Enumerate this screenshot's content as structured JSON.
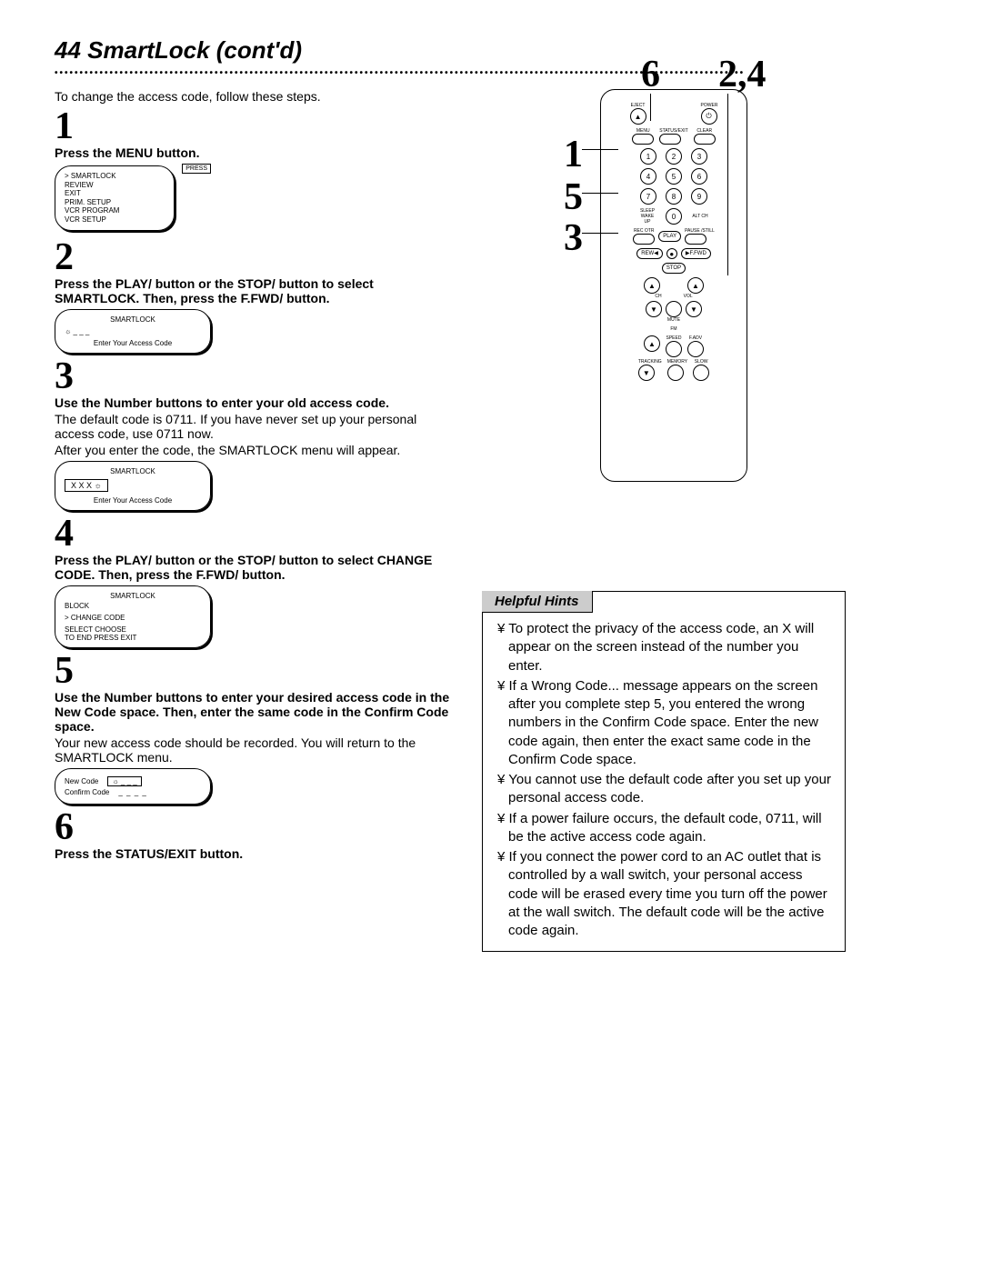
{
  "title": "44  SmartLock (cont'd)",
  "intro": "To change the access code, follow these steps.",
  "steps": {
    "s1": {
      "num": "1",
      "head": "Press the MENU button."
    },
    "s2": {
      "num": "2",
      "head": "Press the PLAY/   button or the STOP/   button to select SMARTLOCK. Then, press the F.FWD/   button."
    },
    "s3": {
      "num": "3",
      "head": "Use the Number buttons to enter your old access code.",
      "body1": "The default code is 0711. If you have never set up your personal access code, use 0711 now.",
      "body2": "After you enter the code, the SMARTLOCK menu will appear."
    },
    "s4": {
      "num": "4",
      "head": "Press the PLAY/   button or the STOP/   button to select CHANGE CODE. Then, press the F.FWD/   button."
    },
    "s5": {
      "num": "5",
      "head": "Use the Number buttons to enter your desired access code in the New Code space. Then, enter the same code in the Confirm Code space.",
      "body": "Your new access code should be recorded. You will return to the SMARTLOCK menu."
    },
    "s6": {
      "num": "6",
      "head": "Press the STATUS/EXIT button."
    }
  },
  "screens": {
    "menu": {
      "pressLabel": "PRESS",
      "items": [
        "> SMARTLOCK",
        "  REVIEW",
        "  EXIT",
        "  PRIM. SETUP",
        "  VCR PROGRAM",
        "  VCR SETUP"
      ]
    },
    "enterCode": {
      "title": "SMARTLOCK",
      "footer": "Enter Your Access Code"
    },
    "enterCodeX": {
      "title": "SMARTLOCK",
      "code": "X   X   X",
      "footer": "Enter Your Access Code"
    },
    "changeCode": {
      "title": "SMARTLOCK",
      "line1": "  BLOCK",
      "line2": "> CHANGE CODE",
      "line3": "SELECT      CHOOSE",
      "line4": "TO END  PRESS EXIT"
    },
    "newConfirm": {
      "l1": "New Code",
      "l2": "Confirm Code"
    }
  },
  "callouts": {
    "c6": "6",
    "c24": "2,4",
    "c1": "1",
    "c5": "5",
    "c3": "3"
  },
  "remote": {
    "topLabels": {
      "eject": "EJECT",
      "power": "POWER",
      "menu": "MENU",
      "status": "STATUS/EXIT",
      "clear": "CLEAR"
    },
    "numbers": [
      "1",
      "2",
      "3",
      "4",
      "5",
      "6",
      "7",
      "8",
      "9",
      "0"
    ],
    "sleep": "SLEEP\nWAKE UP",
    "altch": "ALT CH",
    "rec": "REC\nOTR",
    "play": "PLAY",
    "pause": "PAUSE\n/STILL",
    "rew": "REW",
    "ffwd": "F.FWD",
    "stop": "STOP",
    "ch": "CH",
    "vol": "VOL",
    "mute": "MUTE",
    "fm": "FM",
    "speed": "SPEED",
    "fadv": "F.ADV",
    "tracking": "TRACKING",
    "memory": "MEMORY",
    "slow": "SLOW"
  },
  "hints": {
    "header": "Helpful Hints",
    "items": [
      "¥ To protect the privacy of the access code, an X will appear on the screen instead of the number you enter.",
      "¥ If a  Wrong Code...  message appears on the screen after you complete step 5, you entered the wrong numbers in the Confirm Code space. Enter the new code again, then enter the exact same code in the Confirm Code space.",
      "¥ You cannot use the default code after you set up your personal access code.",
      "¥ If a power failure occurs, the default code, 0711, will be the active access code again.",
      "¥ If you connect the power cord to an AC outlet that is controlled by a wall switch, your personal access code will be erased every time you turn off the power at the wall switch. The default code will be the active code again."
    ]
  }
}
